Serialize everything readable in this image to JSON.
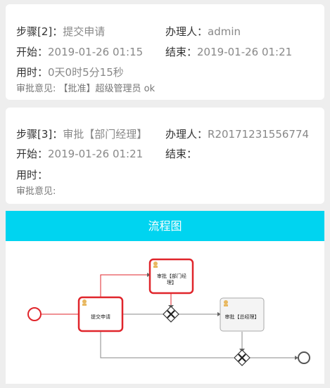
{
  "steps": [
    {
      "step_label": "步骤[2]：",
      "step_value": "提交申请",
      "handler_label": "办理人：",
      "handler_value": "admin",
      "start_label": "开始：",
      "start_value": "2019-01-26 01:15",
      "end_label": "结束：",
      "end_value": "2019-01-26 01:21",
      "duration_label": "用时：",
      "duration_value": "0天0时5分15秒",
      "opinion_label": "审批意见:",
      "opinion_value": "【批准】超级管理员 ok"
    },
    {
      "step_label": "步骤[3]：",
      "step_value": "审批【部门经理】",
      "handler_label": "办理人：",
      "handler_value": "R20171231556774",
      "start_label": "开始：",
      "start_value": "2019-01-26 01:21",
      "end_label": "结束：",
      "end_value": "",
      "duration_label": "用时：",
      "duration_value": "",
      "opinion_label": "审批意见:",
      "opinion_value": ""
    }
  ],
  "flowchart": {
    "title": "流程图",
    "nodes": {
      "submit": "提交申请",
      "dept_manager_line1": "审批【部门经",
      "dept_manager_line2": "理】",
      "general_manager": "审批【总经理】"
    },
    "colors": {
      "header": "#00d4f0",
      "active": "#e0252b",
      "inactive": "#888888"
    }
  }
}
